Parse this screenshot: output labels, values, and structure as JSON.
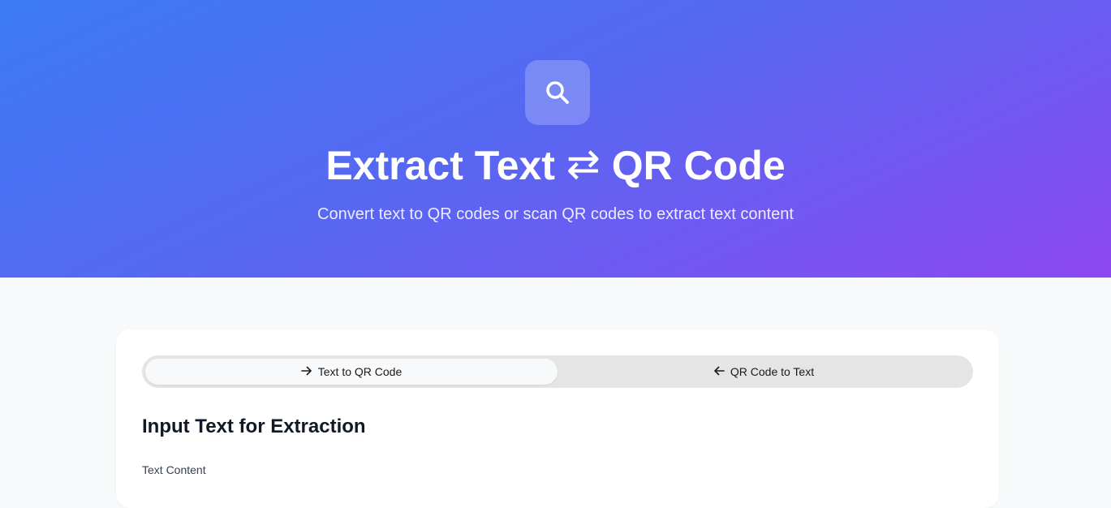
{
  "hero": {
    "icon": "search-icon",
    "title_left": "Extract Text",
    "title_swap": "⇄",
    "title_right": "QR Code",
    "subtitle": "Convert text to QR codes or scan QR codes to extract text content",
    "colors": {
      "gradient_start": "#3b7af5",
      "gradient_end": "#8d47f3"
    }
  },
  "tabs": [
    {
      "label": "Text to QR Code",
      "icon": "arrow-right-icon",
      "active": true
    },
    {
      "label": "QR Code to Text",
      "icon": "arrow-left-icon",
      "active": false
    }
  ],
  "main": {
    "section_title": "Input Text for Extraction",
    "text_content_label": "Text Content"
  }
}
